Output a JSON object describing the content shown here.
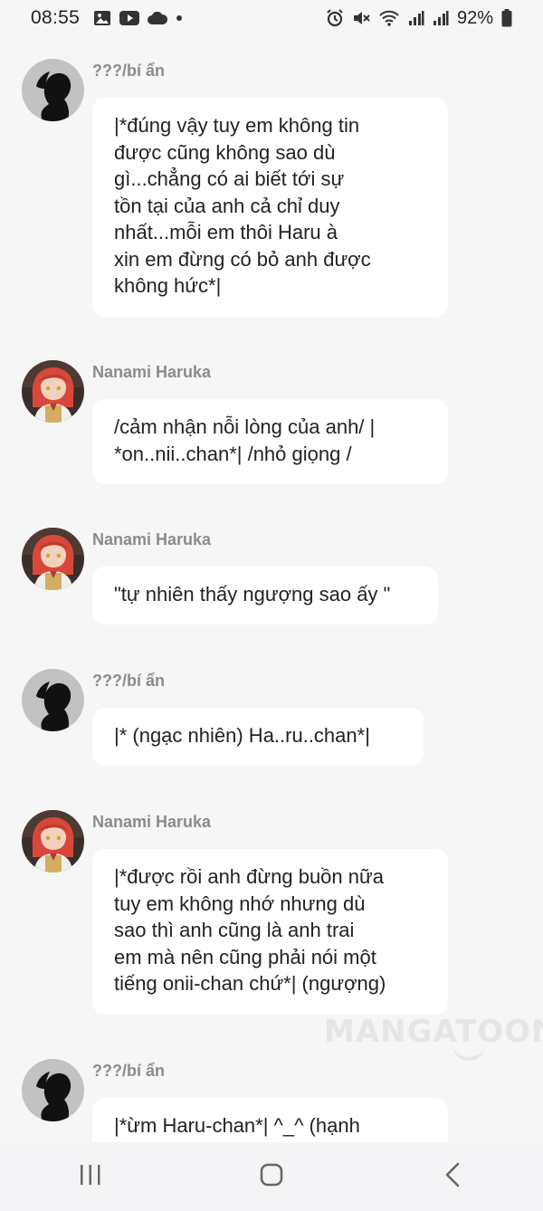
{
  "status_bar": {
    "time": "08:55",
    "battery": "92%",
    "icons_left": [
      "gallery-icon",
      "youtube-icon",
      "cloud-icon",
      "dot-icon"
    ],
    "icons_right": [
      "alarm-icon",
      "mute-icon",
      "wifi-icon",
      "signal-icon",
      "signal-icon",
      "battery-icon"
    ]
  },
  "messages": [
    {
      "sender": "???/bí ẩn",
      "avatar": "silhouette",
      "text": "|*đúng vậy tuy em không tin\nđược cũng không sao dù\ngì...chẳng có ai biết tới sự\ntồn tại của anh cả chỉ duy\nnhất...mỗi em thôi Haru à\nxin em đừng có bỏ anh được\nkhông hức*|"
    },
    {
      "sender": "Nanami Haruka",
      "avatar": "redhead",
      "text": "/cảm nhận nỗi lòng của anh/ |\n*on..nii..chan*| /nhỏ giọng /"
    },
    {
      "sender": "Nanami Haruka",
      "avatar": "redhead",
      "text": "\"tự nhiên thấy ngượng sao ấy \""
    },
    {
      "sender": "???/bí ẩn",
      "avatar": "silhouette",
      "text": "|* (ngạc nhiên) Ha..ru..chan*|"
    },
    {
      "sender": "Nanami Haruka",
      "avatar": "redhead",
      "text": "|*được rồi anh đừng buồn nữa\ntuy em không nhớ nhưng dù\nsao thì anh cũng là anh trai\nem mà nên cũng phải nói một\ntiếng onii-chan chứ*| (ngượng)"
    },
    {
      "sender": "???/bí ẩn",
      "avatar": "silhouette",
      "text": "|*ừm Haru-chan*| ^_^ (hạnh"
    }
  ],
  "watermark": "MANGATOON",
  "nav": {
    "recent": "recent-apps-icon",
    "home": "home-icon",
    "back": "back-icon"
  }
}
